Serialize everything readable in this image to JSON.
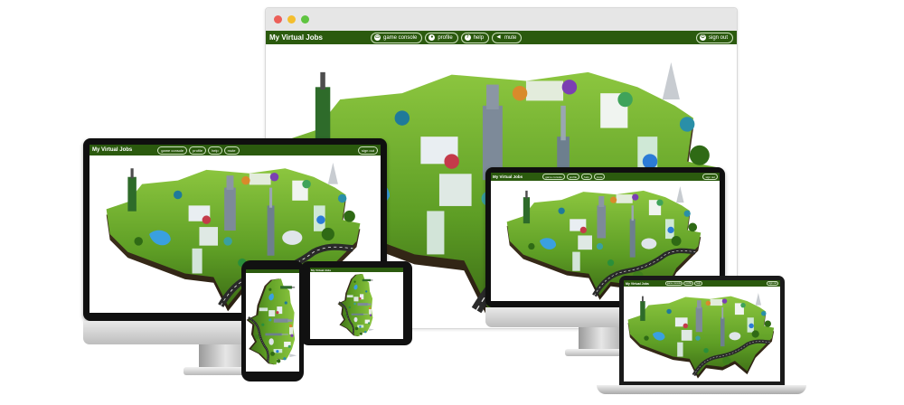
{
  "app": {
    "brand": "My Virtual Jobs",
    "nav": [
      {
        "icon": "game-console-icon",
        "label": "game console"
      },
      {
        "icon": "profile-icon",
        "label": "profile"
      },
      {
        "icon": "help-icon",
        "label": "help"
      },
      {
        "icon": "mute-icon",
        "label": "mute"
      }
    ],
    "signout": {
      "icon": "power-icon",
      "label": "sign out"
    }
  },
  "colors": {
    "appbar": "#2b5a0e",
    "map_green": "#4f8f1f",
    "map_light": "#8cc63f",
    "road": "#2a2a2a",
    "browser_close": "#ec5f58",
    "browser_min": "#f4be2e",
    "browser_max": "#5fc440"
  }
}
